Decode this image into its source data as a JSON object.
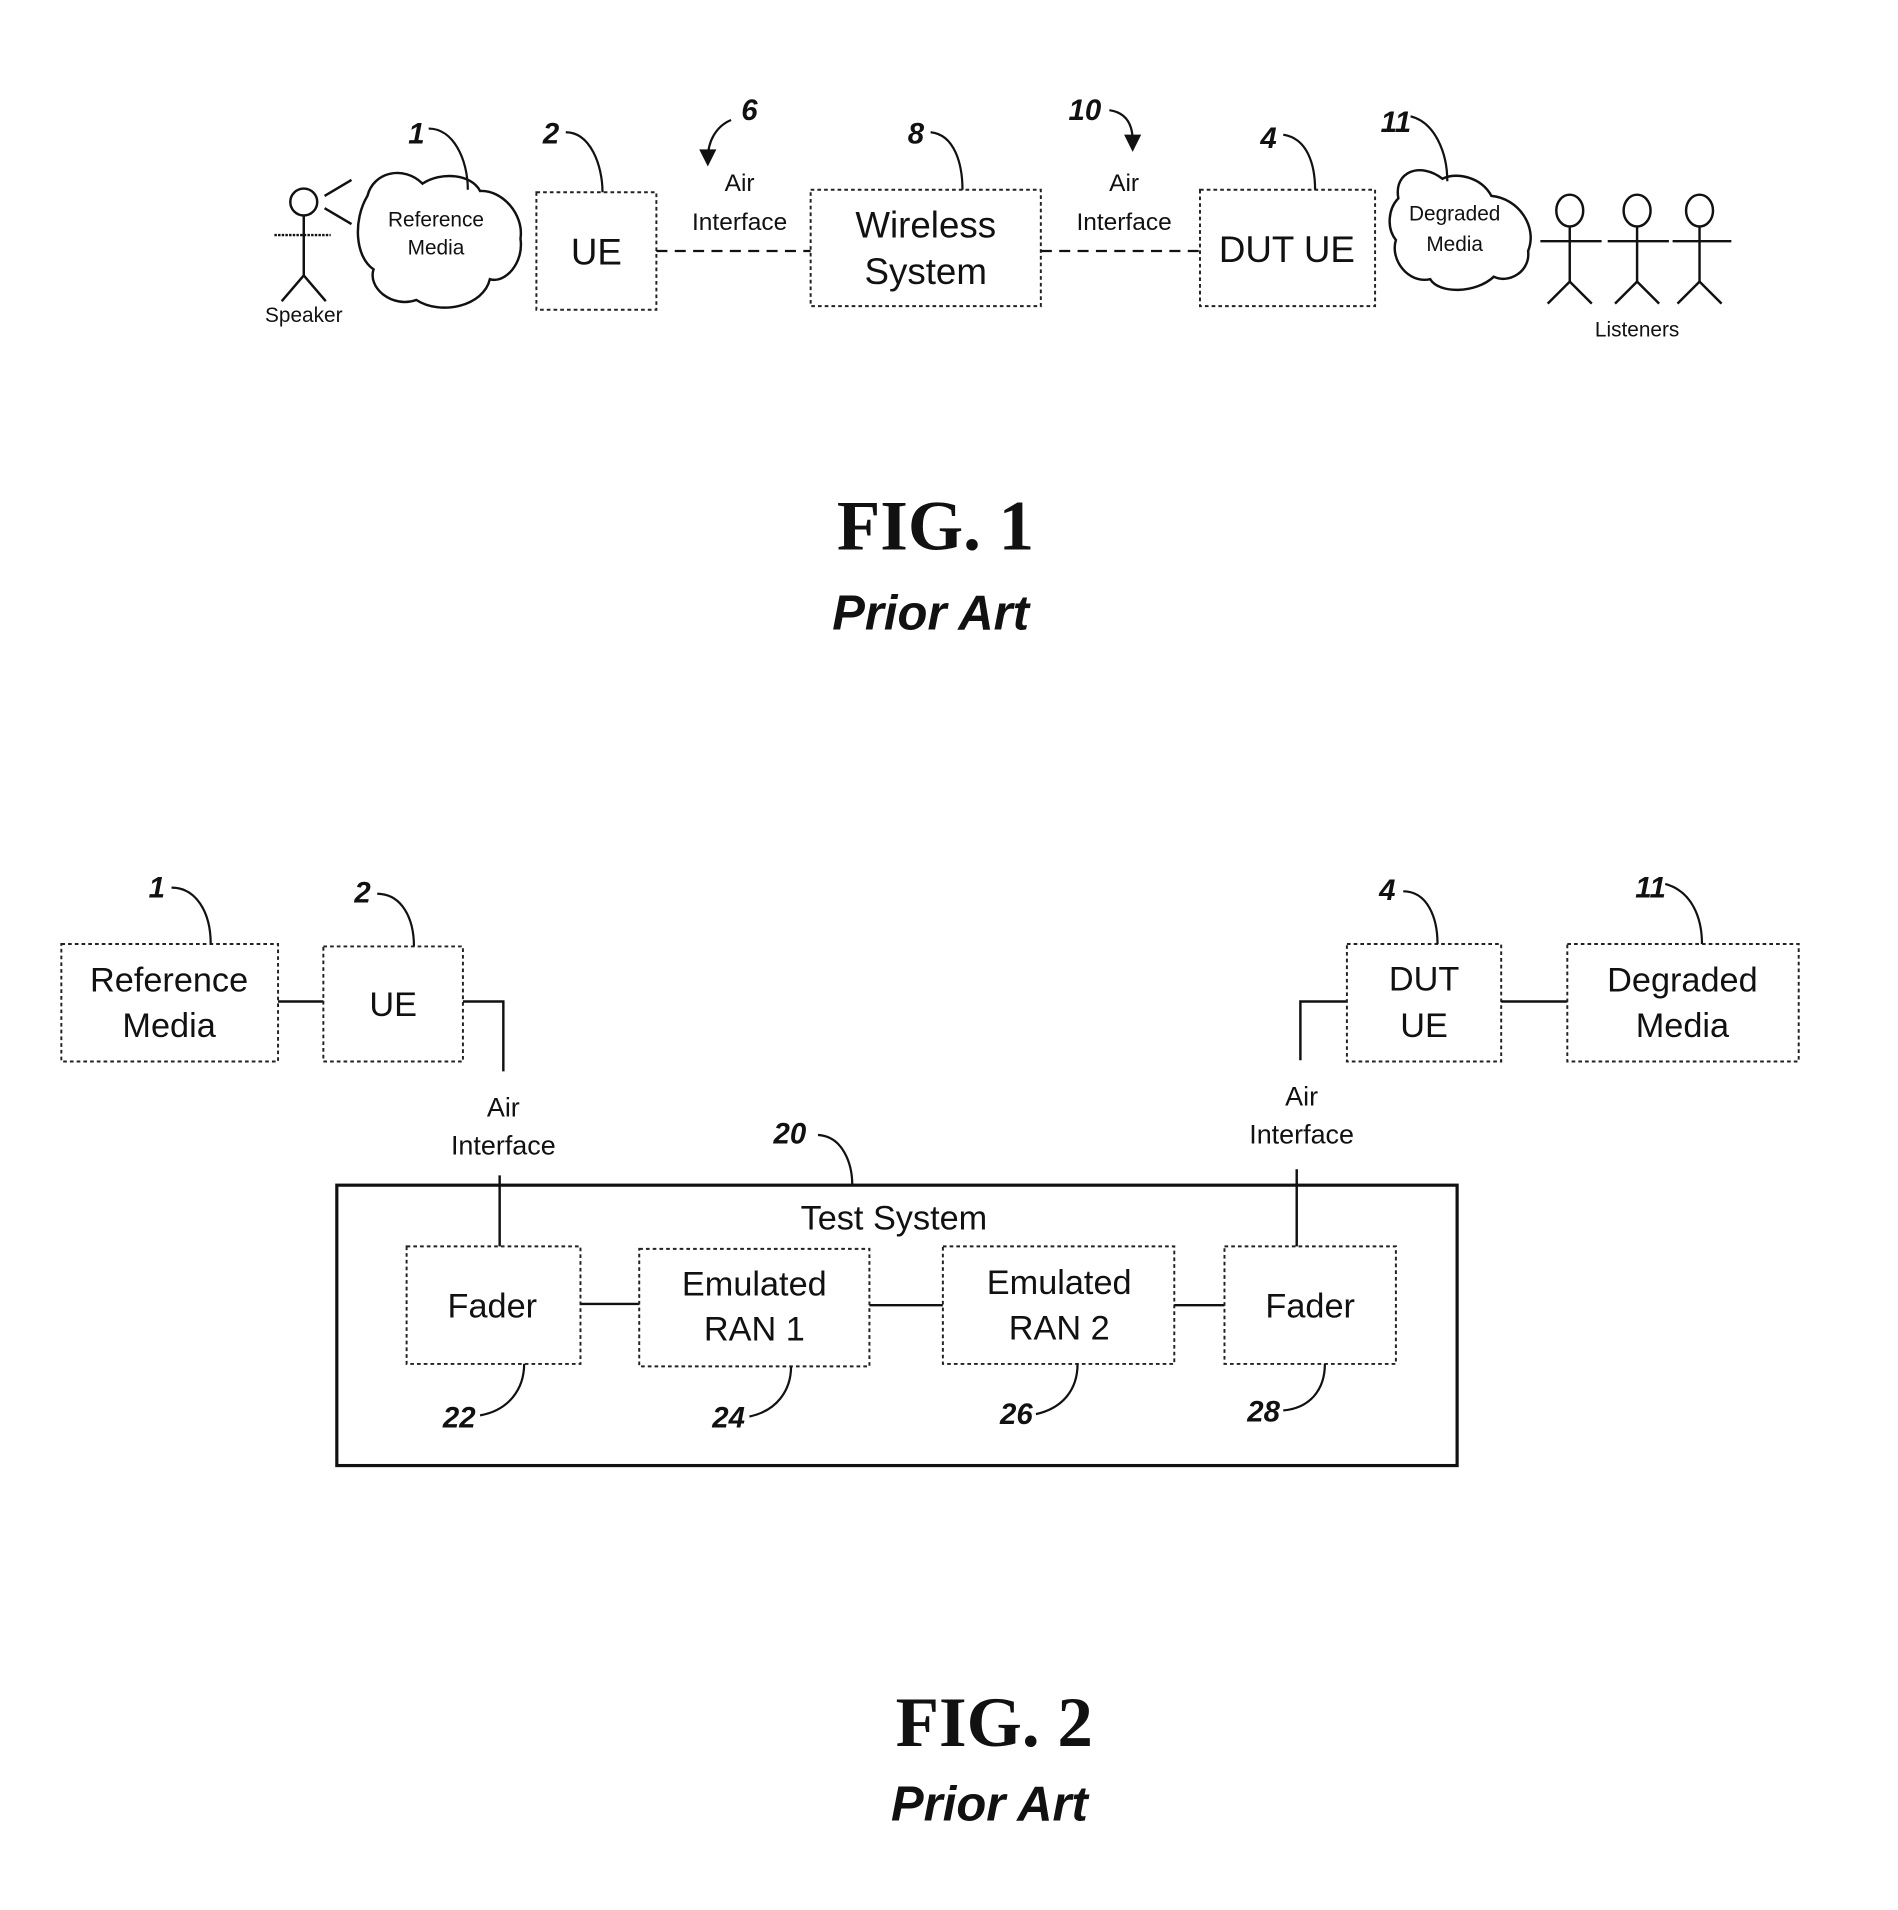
{
  "fig1": {
    "title": "FIG. 1",
    "subtitle": "Prior Art",
    "speaker_label": "Speaker",
    "listeners_label": "Listeners",
    "reference_media": {
      "ref": "1",
      "line1": "Reference",
      "line2": "Media"
    },
    "ue": {
      "ref": "2",
      "label": "UE"
    },
    "air_interface_1": {
      "ref": "6",
      "line1": "Air",
      "line2": "Interface"
    },
    "wireless_system": {
      "ref": "8",
      "line1": "Wireless",
      "line2": "System"
    },
    "air_interface_2": {
      "ref": "10",
      "line1": "Air",
      "line2": "Interface"
    },
    "dut_ue": {
      "ref": "4",
      "label": "DUT UE"
    },
    "degraded_media": {
      "ref": "11",
      "line1": "Degraded",
      "line2": "Media"
    }
  },
  "fig2": {
    "title": "FIG. 2",
    "subtitle": "Prior Art",
    "reference_media": {
      "ref": "1",
      "line1": "Reference",
      "line2": "Media"
    },
    "ue": {
      "ref": "2",
      "label": "UE"
    },
    "air_interface_left": {
      "line1": "Air",
      "line2": "Interface"
    },
    "air_interface_right": {
      "line1": "Air",
      "line2": "Interface"
    },
    "dut_ue": {
      "ref": "4",
      "line1": "DUT",
      "line2": "UE"
    },
    "degraded_media": {
      "ref": "11",
      "line1": "Degraded",
      "line2": "Media"
    },
    "test_system": {
      "ref": "20",
      "label": "Test System"
    },
    "fader_1": {
      "ref": "22",
      "label": "Fader"
    },
    "emulated_ran_1": {
      "ref": "24",
      "line1": "Emulated",
      "line2": "RAN 1"
    },
    "emulated_ran_2": {
      "ref": "26",
      "line1": "Emulated",
      "line2": "RAN 2"
    },
    "fader_2": {
      "ref": "28",
      "label": "Fader"
    }
  }
}
